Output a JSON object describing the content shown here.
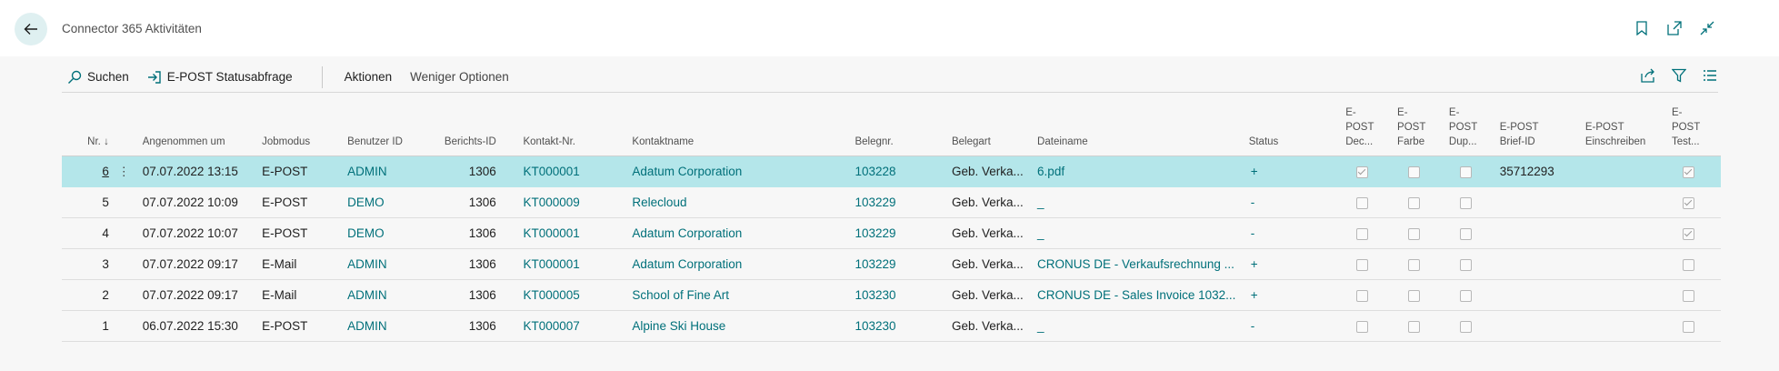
{
  "header": {
    "title": "Connector 365 Aktivitäten"
  },
  "actions": {
    "search": "Suchen",
    "status_query": "E-POST Statusabfrage",
    "actions_menu": "Aktionen",
    "fewer_options": "Weniger Optionen"
  },
  "columns": {
    "nr": "Nr.",
    "nr_sort": "↓",
    "accepted": "Angenommen um",
    "jobmode": "Jobmodus",
    "user": "Benutzer ID",
    "report": "Berichts-ID",
    "contact_no": "Kontakt-Nr.",
    "contact_name": "Kontaktname",
    "doc_no": "Belegnr.",
    "doc_type": "Belegart",
    "file": "Dateiname",
    "status": "Status",
    "ep_dec_1": "E-",
    "ep_dec_2": "POST",
    "ep_dec_3": "Dec...",
    "ep_color_1": "E-",
    "ep_color_2": "POST",
    "ep_color_3": "Farbe",
    "ep_dup_1": "E-",
    "ep_dup_2": "POST",
    "ep_dup_3": "Dup...",
    "ep_letter_1": "E-POST",
    "ep_letter_2": "Brief-ID",
    "ep_reg_1": "E-POST",
    "ep_reg_2": "Einschreiben",
    "ep_test_1": "E-",
    "ep_test_2": "POST",
    "ep_test_3": "Test..."
  },
  "rows": [
    {
      "nr": "6",
      "date": "07.07.2022 13:15",
      "mode": "E-POST",
      "user": "ADMIN",
      "report": "1306",
      "contact": "KT000001",
      "name": "Adatum Corporation",
      "doc": "103228",
      "type": "Geb. Verka...",
      "file": "6.pdf",
      "status": "+",
      "dec": true,
      "color": false,
      "dup": false,
      "letter": "35712293",
      "reg": "",
      "test": true,
      "selected": true
    },
    {
      "nr": "5",
      "date": "07.07.2022 10:09",
      "mode": "E-POST",
      "user": "DEMO",
      "report": "1306",
      "contact": "KT000009",
      "name": "Relecloud",
      "doc": "103229",
      "type": "Geb. Verka...",
      "file": "_",
      "status": "-",
      "dec": false,
      "color": false,
      "dup": false,
      "letter": "",
      "reg": "",
      "test": true
    },
    {
      "nr": "4",
      "date": "07.07.2022 10:07",
      "mode": "E-POST",
      "user": "DEMO",
      "report": "1306",
      "contact": "KT000001",
      "name": "Adatum Corporation",
      "doc": "103229",
      "type": "Geb. Verka...",
      "file": "_",
      "status": "-",
      "dec": false,
      "color": false,
      "dup": false,
      "letter": "",
      "reg": "",
      "test": true
    },
    {
      "nr": "3",
      "date": "07.07.2022 09:17",
      "mode": "E-Mail",
      "user": "ADMIN",
      "report": "1306",
      "contact": "KT000001",
      "name": "Adatum Corporation",
      "doc": "103229",
      "type": "Geb. Verka...",
      "file": "CRONUS DE - Verkaufsrechnung ...",
      "status": "+",
      "dec": false,
      "color": false,
      "dup": false,
      "letter": "",
      "reg": "",
      "test": false
    },
    {
      "nr": "2",
      "date": "07.07.2022 09:17",
      "mode": "E-Mail",
      "user": "ADMIN",
      "report": "1306",
      "contact": "KT000005",
      "name": "School of Fine Art",
      "doc": "103230",
      "type": "Geb. Verka...",
      "file": "CRONUS DE - Sales Invoice 1032...",
      "status": "+",
      "dec": false,
      "color": false,
      "dup": false,
      "letter": "",
      "reg": "",
      "test": false
    },
    {
      "nr": "1",
      "date": "06.07.2022 15:30",
      "mode": "E-POST",
      "user": "ADMIN",
      "report": "1306",
      "contact": "KT000007",
      "name": "Alpine Ski House",
      "doc": "103230",
      "type": "Geb. Verka...",
      "file": "_",
      "status": "-",
      "dec": false,
      "color": false,
      "dup": false,
      "letter": "",
      "reg": "",
      "test": false
    }
  ],
  "colors": {
    "accent": "#00707a",
    "selected_row": "#b4e6ea",
    "back_button_bg": "#dff0f1"
  }
}
